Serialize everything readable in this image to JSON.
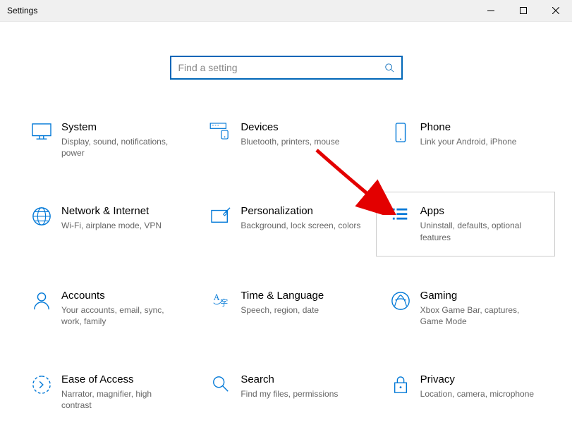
{
  "titlebar": {
    "title": "Settings"
  },
  "search": {
    "placeholder": "Find a setting"
  },
  "tiles": {
    "system": {
      "title": "System",
      "desc": "Display, sound, notifications, power"
    },
    "devices": {
      "title": "Devices",
      "desc": "Bluetooth, printers, mouse"
    },
    "phone": {
      "title": "Phone",
      "desc": "Link your Android, iPhone"
    },
    "network": {
      "title": "Network & Internet",
      "desc": "Wi-Fi, airplane mode, VPN"
    },
    "personalization": {
      "title": "Personalization",
      "desc": "Background, lock screen, colors"
    },
    "apps": {
      "title": "Apps",
      "desc": "Uninstall, defaults, optional features"
    },
    "accounts": {
      "title": "Accounts",
      "desc": "Your accounts, email, sync, work, family"
    },
    "time": {
      "title": "Time & Language",
      "desc": "Speech, region, date"
    },
    "gaming": {
      "title": "Gaming",
      "desc": "Xbox Game Bar, captures, Game Mode"
    },
    "ease": {
      "title": "Ease of Access",
      "desc": "Narrator, magnifier, high contrast"
    },
    "search_cat": {
      "title": "Search",
      "desc": "Find my files, permissions"
    },
    "privacy": {
      "title": "Privacy",
      "desc": "Location, camera, microphone"
    }
  }
}
